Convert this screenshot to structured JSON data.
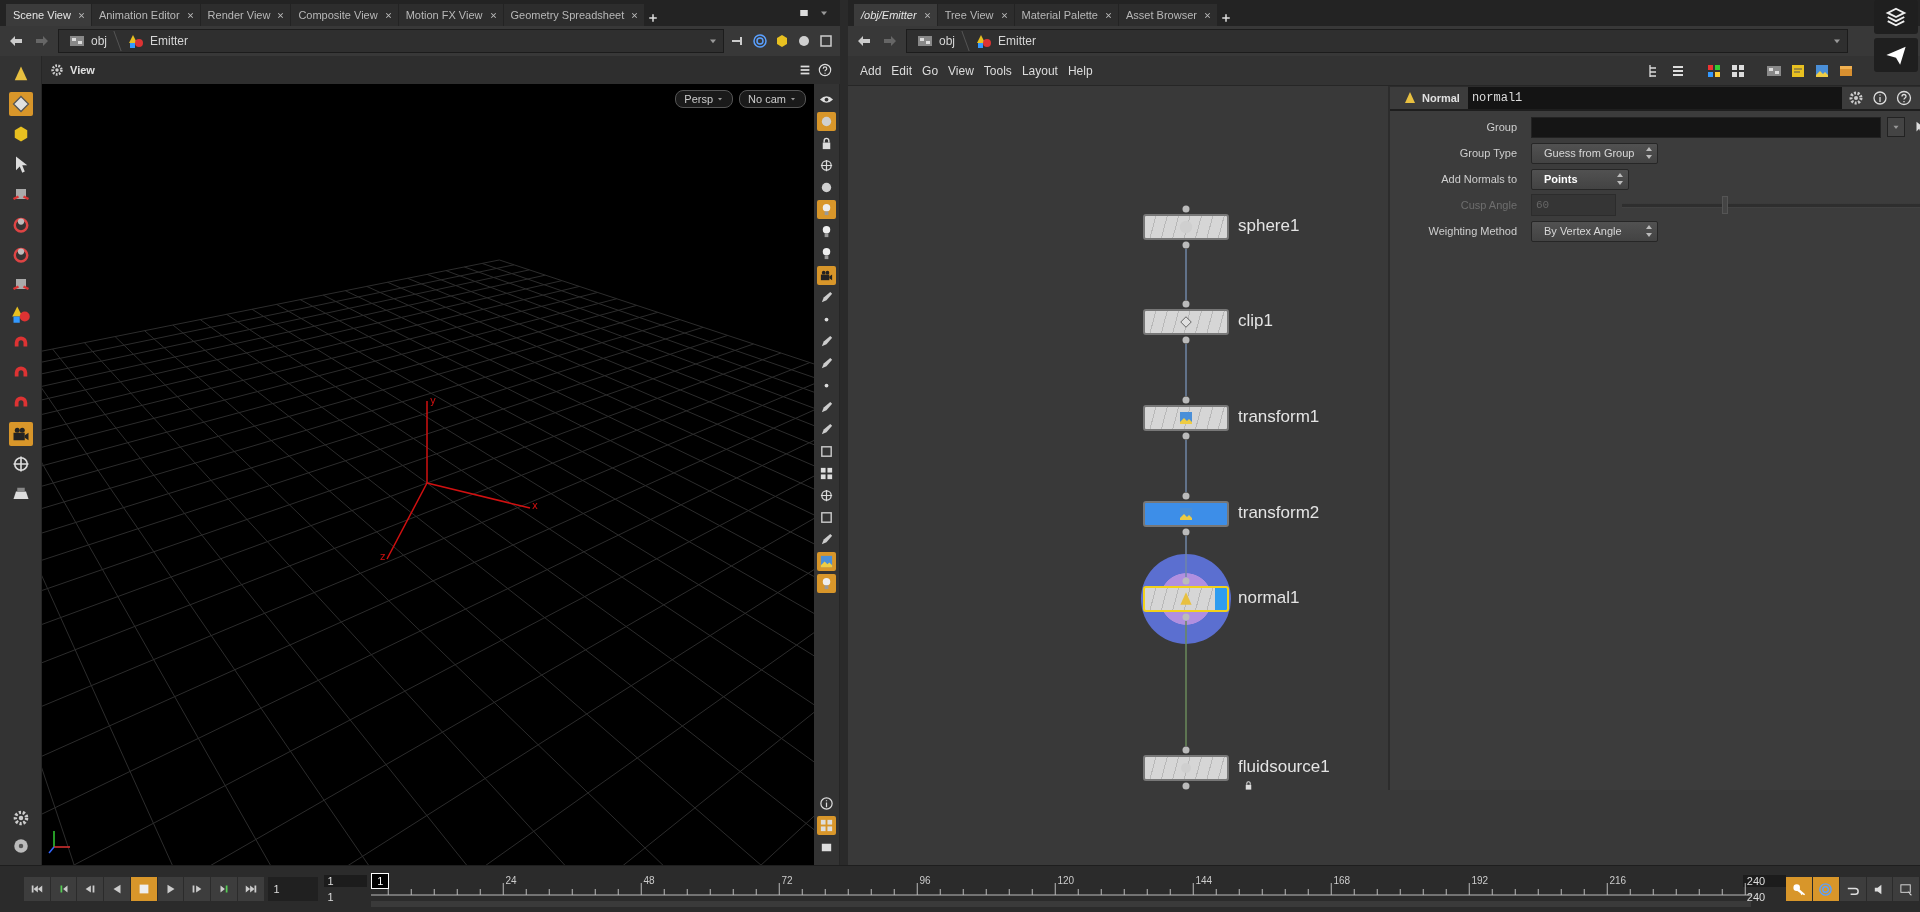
{
  "left_pane": {
    "tabs": [
      {
        "label": "Scene View",
        "selected": true
      },
      {
        "label": "Animation Editor",
        "selected": false
      },
      {
        "label": "Render View",
        "selected": false
      },
      {
        "label": "Composite View",
        "selected": false
      },
      {
        "label": "Motion FX View",
        "selected": false
      },
      {
        "label": "Geometry Spreadsheet",
        "selected": false
      }
    ],
    "path": [
      "obj",
      "Emitter"
    ],
    "view_title": "View",
    "viewport": {
      "camera_menus": [
        "Persp",
        "No cam"
      ],
      "axis_labels": [
        "y",
        "x",
        "z"
      ]
    },
    "left_tools": [
      {
        "selected": false
      },
      {
        "selected": true
      },
      {
        "selected": false
      },
      {
        "selected": false
      },
      {
        "selected": false
      },
      {
        "selected": false
      },
      {
        "selected": false
      },
      {
        "selected": false
      },
      {
        "selected": false
      },
      {
        "selected": false
      },
      {
        "selected": false
      },
      {
        "selected": false
      },
      {
        "selected": true
      },
      {
        "selected": false
      },
      {
        "selected": false
      }
    ],
    "right_tools": [
      {
        "selected": false
      },
      {
        "selected": true
      },
      {
        "selected": false
      },
      {
        "selected": false
      },
      {
        "selected": false
      },
      {
        "selected": true
      },
      {
        "selected": false
      },
      {
        "selected": false
      },
      {
        "selected": true
      },
      {
        "selected": false
      },
      {
        "selected": false
      },
      {
        "selected": false
      },
      {
        "selected": false
      },
      {
        "selected": false
      },
      {
        "selected": false
      },
      {
        "selected": false
      },
      {
        "selected": false
      },
      {
        "selected": false
      },
      {
        "selected": false
      },
      {
        "selected": false
      },
      {
        "selected": false
      },
      {
        "selected": true
      },
      {
        "selected": true
      }
    ],
    "right_tools_bottom": [
      {
        "selected": false
      },
      {
        "selected": true
      },
      {
        "selected": false
      }
    ]
  },
  "right_pane": {
    "tabs": [
      {
        "label": "/obj/Emitter",
        "selected": true
      },
      {
        "label": "Tree View",
        "selected": false
      },
      {
        "label": "Material Palette",
        "selected": false
      },
      {
        "label": "Asset Browser",
        "selected": false
      }
    ],
    "path": [
      "obj",
      "Emitter"
    ],
    "menu": [
      "Add",
      "Edit",
      "Go",
      "View",
      "Tools",
      "Layout",
      "Help"
    ],
    "network": {
      "nodes": [
        {
          "name": "sphere1",
          "kind": "sphere",
          "selected": false,
          "current": false,
          "display": false
        },
        {
          "name": "clip1",
          "kind": "clip",
          "selected": false,
          "current": false,
          "display": false
        },
        {
          "name": "transform1",
          "kind": "transform",
          "selected": false,
          "current": false,
          "display": false
        },
        {
          "name": "transform2",
          "kind": "transform",
          "selected": true,
          "current": false,
          "display": false
        },
        {
          "name": "normal1",
          "kind": "normal",
          "selected": false,
          "current": true,
          "display": true
        },
        {
          "name": "fluidsource1",
          "kind": "fluidsource",
          "selected": false,
          "current": false,
          "display": false,
          "locked": true
        }
      ]
    },
    "parameters": {
      "type": "Normal",
      "name": "normal1",
      "fields": [
        {
          "label": "Group",
          "kind": "text",
          "disabled": false
        },
        {
          "label": "Group Type",
          "kind": "menu",
          "value": "Guess from Group",
          "disabled": false,
          "changed": false
        },
        {
          "label": "Add Normals to",
          "kind": "menu",
          "value": "Points",
          "disabled": false,
          "changed": true
        },
        {
          "label": "Cusp Angle",
          "kind": "slider",
          "value": "60",
          "level": 0.34,
          "disabled": true
        },
        {
          "label": "Weighting Method",
          "kind": "menu",
          "value": "By Vertex Angle",
          "disabled": false,
          "changed": false
        }
      ]
    }
  },
  "timeline": {
    "transport": [
      {
        "selected": false
      },
      {
        "selected": false
      },
      {
        "selected": false
      },
      {
        "selected": false
      },
      {
        "selected": true
      },
      {
        "selected": false
      },
      {
        "selected": false
      },
      {
        "selected": false
      },
      {
        "selected": false
      }
    ],
    "frame": "1",
    "range_start": [
      "1",
      "1"
    ],
    "current_marker": "1",
    "ticks": [
      "24",
      "48",
      "72",
      "96",
      "120",
      "144",
      "168",
      "192",
      "216"
    ],
    "range_end": [
      "240",
      "240"
    ],
    "tools": [
      {
        "selected": true
      },
      {
        "selected": true
      },
      {
        "selected": false
      },
      {
        "selected": false
      },
      {
        "selected": false
      }
    ]
  }
}
